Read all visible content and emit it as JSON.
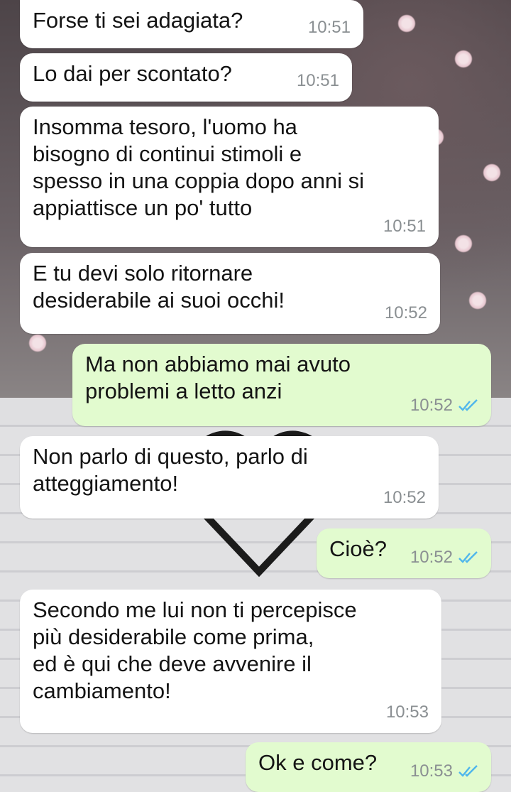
{
  "conversation": {
    "messages": [
      {
        "direction": "in",
        "text": "Forse ti sei adagiata?",
        "time": "10:51"
      },
      {
        "direction": "in",
        "text": "Lo dai per scontato?",
        "time": "10:51"
      },
      {
        "direction": "in",
        "text": "Insomma tesoro, l'uomo ha\nbisogno di continui stimoli e\nspesso in una coppia dopo anni si\nappiattisce un po' tutto",
        "time": "10:51"
      },
      {
        "direction": "in",
        "text": "E tu devi solo ritornare\ndesiderabile ai suoi occhi!",
        "time": "10:52"
      },
      {
        "direction": "out",
        "text": "Ma non abbiamo mai avuto\nproblemi a letto anzi",
        "time": "10:52",
        "status": "read"
      },
      {
        "direction": "in",
        "text": "Non parlo di questo, parlo di\natteggiamento!",
        "time": "10:52"
      },
      {
        "direction": "out",
        "text": "Cioè?",
        "time": "10:52",
        "status": "read"
      },
      {
        "direction": "in",
        "text": "Secondo me lui non ti percepisce\npiù desiderabile come prima,\ned è qui che deve avvenire il\ncambiamento!",
        "time": "10:53"
      },
      {
        "direction": "out",
        "text": "Ok e come?",
        "time": "10:53",
        "status": "read"
      }
    ]
  },
  "colors": {
    "incoming_bubble": "#ffffff",
    "outgoing_bubble": "#e2fbcf",
    "read_ticks": "#4fb6ec",
    "timestamp": "#8a8f92"
  }
}
